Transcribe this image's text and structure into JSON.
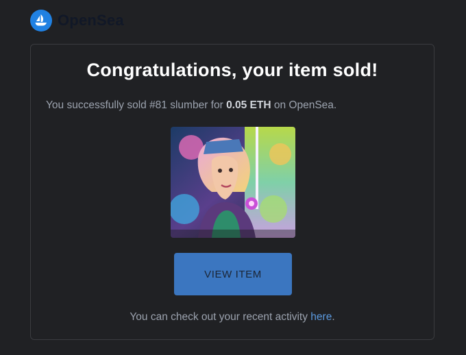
{
  "header": {
    "brand": "OpenSea",
    "logo_icon": "opensea-boat-icon"
  },
  "card": {
    "title": "Congratulations, your item sold!",
    "message": {
      "prefix": "You successfully sold #81 slumber for ",
      "amount": "0.05 ETH",
      "suffix": " on OpenSea."
    },
    "image_icon": "nft-artwork-image",
    "button_label": "VIEW ITEM",
    "footer": {
      "text": "You can check out your recent activity ",
      "link": "here",
      "end": "."
    }
  },
  "colors": {
    "background": "#202124",
    "accent": "#2081e2",
    "button": "#3b76c0",
    "link": "#5b9ae0"
  }
}
